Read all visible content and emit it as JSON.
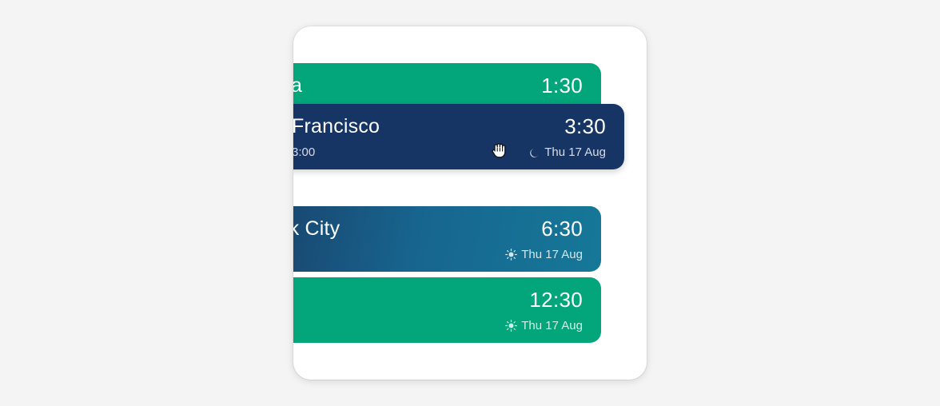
{
  "cards": [
    {
      "city": "a",
      "time": "1:30",
      "subtitle": ""
    },
    {
      "city": "Francisco",
      "time": "3:30",
      "left_sub": "3:00",
      "date": "Thu 17 Aug",
      "icon": "moon-icon"
    },
    {
      "city": "ork City",
      "time": "6:30",
      "date": "Thu 17 Aug",
      "icon": "sun-icon"
    },
    {
      "city": "",
      "time": "12:30",
      "date": "Thu 17 Aug",
      "icon": "sun-icon"
    }
  ],
  "colors": {
    "background": "#f4f4f4",
    "green": "#03a57a",
    "navy": "#163565",
    "teal_gradient_start": "#18466f",
    "teal_gradient_end": "#167898"
  },
  "cursor": "grab-hand-icon"
}
